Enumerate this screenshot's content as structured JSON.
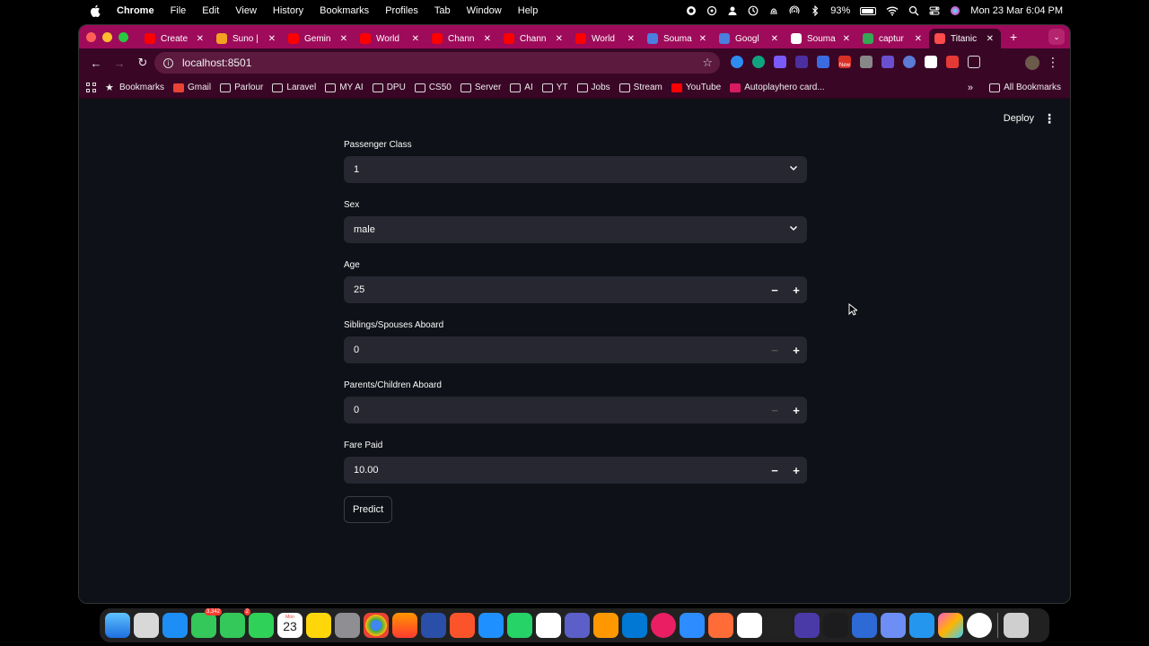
{
  "menubar": {
    "app_name": "Chrome",
    "items": [
      "File",
      "Edit",
      "View",
      "History",
      "Bookmarks",
      "Profiles",
      "Tab",
      "Window",
      "Help"
    ],
    "battery_percent": "93%",
    "battery_level": 0.93,
    "datetime": "Mon 23 Mar  6:04 PM"
  },
  "browser": {
    "tabs": [
      {
        "title": "Create",
        "favicon_color": "#ff0000"
      },
      {
        "title": "Suno |",
        "favicon_color": "#f4a020"
      },
      {
        "title": "Gemin",
        "favicon_color": "#ff0000"
      },
      {
        "title": "World",
        "favicon_color": "#ff0000"
      },
      {
        "title": "Chann",
        "favicon_color": "#ff0000"
      },
      {
        "title": "Chann",
        "favicon_color": "#ff0000"
      },
      {
        "title": "World",
        "favicon_color": "#ff0000"
      },
      {
        "title": "Souma",
        "favicon_color": "#4a7fe0"
      },
      {
        "title": "Googl",
        "favicon_color": "#4a7fe0"
      },
      {
        "title": "Souma",
        "favicon_color": "#ffffff"
      },
      {
        "title": "captur",
        "favicon_color": "#34a853"
      },
      {
        "title": "Titanic",
        "favicon_color": "#ff4b4b"
      }
    ],
    "active_tab_index": 11,
    "url": "localhost:8501",
    "extension_badge": "New",
    "bookmarks": [
      {
        "label": "Bookmarks",
        "icon": "star-icon"
      },
      {
        "label": "Gmail",
        "icon": "gmail-icon"
      },
      {
        "label": "Parlour",
        "icon": "folder-icon"
      },
      {
        "label": "Laravel",
        "icon": "folder-icon"
      },
      {
        "label": "MY AI",
        "icon": "folder-icon"
      },
      {
        "label": "DPU",
        "icon": "folder-icon"
      },
      {
        "label": "CS50",
        "icon": "folder-icon"
      },
      {
        "label": "Server",
        "icon": "folder-icon"
      },
      {
        "label": "AI",
        "icon": "folder-icon"
      },
      {
        "label": "YT",
        "icon": "folder-icon"
      },
      {
        "label": "Jobs",
        "icon": "folder-icon"
      },
      {
        "label": "Stream",
        "icon": "folder-icon"
      },
      {
        "label": "YouTube",
        "icon": "youtube-icon"
      },
      {
        "label": "Autoplayhero card...",
        "icon": "autoplay-icon"
      }
    ],
    "all_bookmarks_label": "All Bookmarks",
    "theme": {
      "tabbar": "#9e0b5a",
      "toolbar": "#3a0626"
    }
  },
  "app": {
    "deploy_label": "Deploy",
    "fields": {
      "pclass": {
        "label": "Passenger Class",
        "value": "1"
      },
      "sex": {
        "label": "Sex",
        "value": "male"
      },
      "age": {
        "label": "Age",
        "value": "25"
      },
      "sibsp": {
        "label": "Siblings/Spouses Aboard",
        "value": "0"
      },
      "parch": {
        "label": "Parents/Children Aboard",
        "value": "0"
      },
      "fare": {
        "label": "Fare Paid",
        "value": "10.00"
      }
    },
    "predict_label": "Predict",
    "colors": {
      "background": "#0e1117",
      "input": "#262730",
      "text": "#fafafa"
    }
  },
  "dock": {
    "badges": {
      "mail": "3,342",
      "phone": "2",
      "calendar_month": "Mon",
      "calendar_day": "23"
    }
  }
}
